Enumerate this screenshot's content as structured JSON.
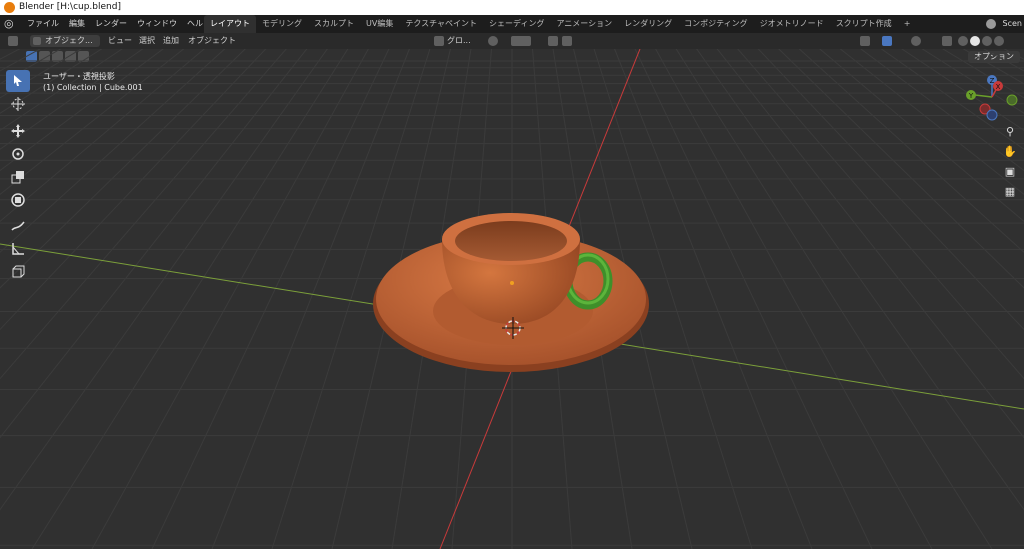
{
  "window": {
    "title": "Blender [H:\\cup.blend]"
  },
  "menus": [
    "ファイル",
    "編集",
    "レンダー",
    "ウィンドウ",
    "ヘルプ"
  ],
  "workspaces": [
    {
      "label": "レイアウト",
      "active": true
    },
    {
      "label": "モデリング"
    },
    {
      "label": "スカルプト"
    },
    {
      "label": "UV編集"
    },
    {
      "label": "テクスチャペイント"
    },
    {
      "label": "シェーディング"
    },
    {
      "label": "アニメーション"
    },
    {
      "label": "レンダリング"
    },
    {
      "label": "コンポジティング"
    },
    {
      "label": "ジオメトリノード"
    },
    {
      "label": "スクリプト作成"
    },
    {
      "label": "+"
    }
  ],
  "scene": {
    "label": "Scen"
  },
  "header": {
    "mode": "オブジェク...",
    "view": "ビュー",
    "select": "選択",
    "add": "追加",
    "object": "オブジェクト",
    "orientation": "グロ...",
    "options": "オプション"
  },
  "viewport": {
    "view_name": "ユーザー・透視投影",
    "collection": "(1) Collection | Cube.001"
  },
  "gizmo": {
    "x": "X",
    "y": "Y",
    "z": "Z"
  },
  "colors": {
    "accent": "#4772b3",
    "cup": "#c8693a",
    "handle": "#3f8f2a",
    "x_axis": "#c83a3a",
    "y_axis": "#7ca03a"
  }
}
